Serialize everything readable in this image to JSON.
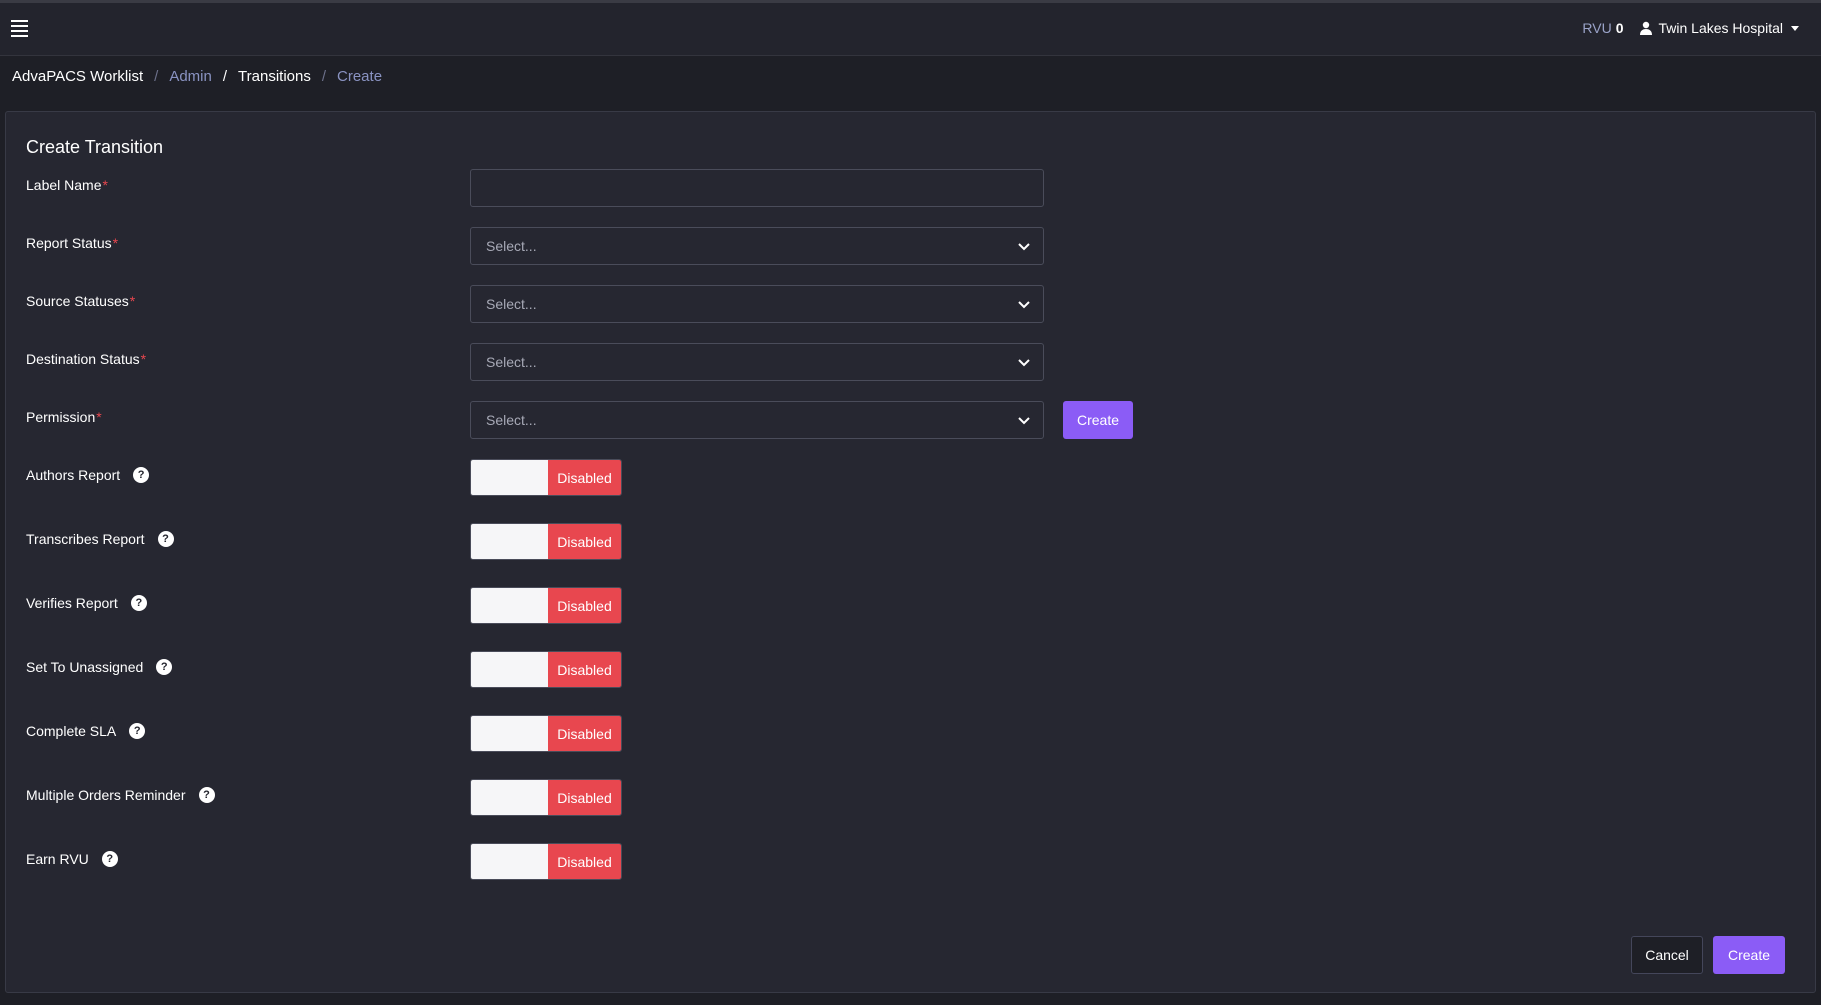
{
  "navbar": {
    "rvu_label": "RVU",
    "rvu_value": "0",
    "user_name": "Twin Lakes Hospital",
    "icons": [
      "hamburger-menu-icon",
      "user-icon",
      "caret-down-icon"
    ]
  },
  "breadcrumb": {
    "items": [
      "AdvaPACS Worklist",
      "Admin",
      "Transitions",
      "Create"
    ],
    "separator": "/"
  },
  "form": {
    "title": "Create Transition",
    "required_mark": "*",
    "label_name": {
      "label": "Label Name",
      "value": ""
    },
    "report_status": {
      "label": "Report Status",
      "placeholder": "Select..."
    },
    "source_statuses": {
      "label": "Source Statuses",
      "placeholder": "Select..."
    },
    "destination_status": {
      "label": "Destination Status",
      "placeholder": "Select..."
    },
    "permission": {
      "label": "Permission",
      "placeholder": "Select...",
      "create_label": "Create"
    },
    "help_glyph": "?",
    "toggles": [
      {
        "label": "Authors Report",
        "state": "Disabled"
      },
      {
        "label": "Transcribes Report",
        "state": "Disabled"
      },
      {
        "label": "Verifies Report",
        "state": "Disabled"
      },
      {
        "label": "Set To Unassigned",
        "state": "Disabled"
      },
      {
        "label": "Complete SLA",
        "state": "Disabled"
      },
      {
        "label": "Multiple Orders Reminder",
        "state": "Disabled"
      },
      {
        "label": "Earn RVU",
        "state": "Disabled"
      }
    ],
    "cancel_label": "Cancel",
    "submit_label": "Create"
  },
  "colors": {
    "page_bg": "#1e1f26",
    "card_bg": "#262731",
    "accent": "#8b5cf6",
    "disabled_red": "#e8474f",
    "link": "#8a93c2"
  }
}
